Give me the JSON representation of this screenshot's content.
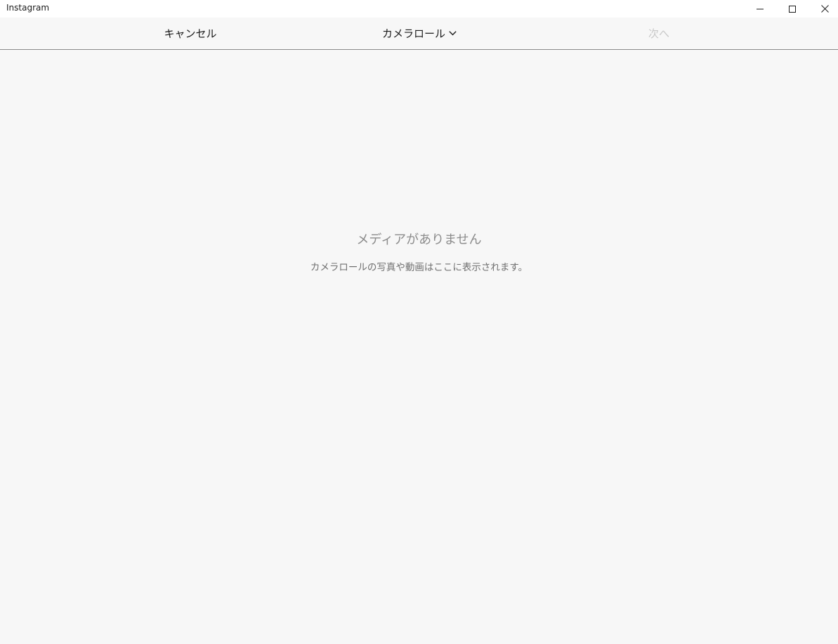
{
  "window": {
    "title": "Instagram",
    "controls": {
      "minimize_icon": "minimize-icon",
      "maximize_icon": "maximize-icon",
      "close_icon": "close-icon"
    }
  },
  "toolbar": {
    "cancel_label": "キャンセル",
    "source_label": "カメラロール",
    "source_icon": "chevron-down-icon",
    "next_label": "次へ",
    "next_color": "#c8c8c8"
  },
  "empty_state": {
    "title": "メディアがありません",
    "message": "カメラロールの写真や動画はここに表示されます。"
  },
  "colors": {
    "background": "#f7f7f7",
    "titlebar": "#ffffff",
    "divider": "#8a8a8a",
    "text_primary": "#1a1a1a",
    "text_muted": "#8c8c8c"
  }
}
